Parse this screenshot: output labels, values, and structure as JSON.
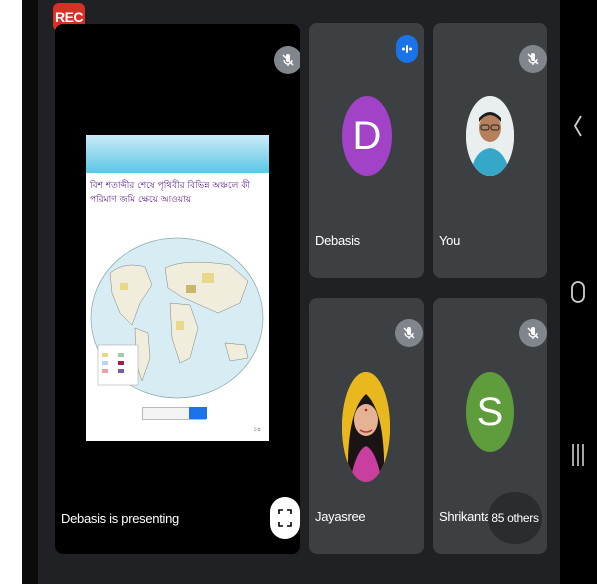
{
  "recording": {
    "label": "REC",
    "color": "#d93025"
  },
  "presentation": {
    "presenter_label": "Debasis is presenting",
    "slide": {
      "title": "বিশ শতাব্দীর শেষে পৃথিবীর বিভিন্ন অঞ্চলে কী পরিমাণ জমি ক্ষেয়ে আওয়ায়",
      "page_number": "১৪"
    },
    "fullscreen_icon": "fullscreen-icon"
  },
  "participants": [
    {
      "name": "Debasis",
      "avatar_letter": "D",
      "avatar_color": "#a142c7",
      "status": "talking"
    },
    {
      "name": "You",
      "avatar_type": "photo",
      "status": "muted"
    },
    {
      "name": "Jayasree",
      "avatar_type": "photo",
      "status": "muted"
    },
    {
      "name": "Shrikanta",
      "avatar_letter": "S",
      "avatar_color": "#5f9d3c",
      "status": "muted"
    }
  ],
  "others": {
    "label": "85 others"
  },
  "nav": {
    "back_icon": "back-icon",
    "home_icon": "home-icon",
    "recents_icon": "recents-icon"
  }
}
